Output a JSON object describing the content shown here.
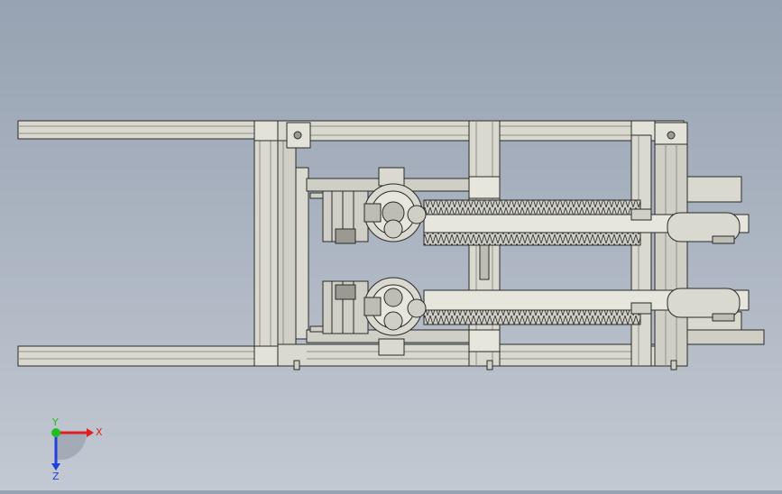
{
  "viewport": {
    "background_top": "#97a2b2",
    "background_bottom": "#c3c9d2"
  },
  "model": {
    "frame_color": "#d9d9cf",
    "frame_shadow": "#8f8f86",
    "edge_color": "#2a2a2a",
    "detail_color": "#bdbdb4"
  },
  "triad": {
    "x_label": "X",
    "y_label": "Y",
    "z_label": "Z",
    "x_color": "#e02020",
    "y_color": "#20c020",
    "z_color": "#2040e0"
  }
}
